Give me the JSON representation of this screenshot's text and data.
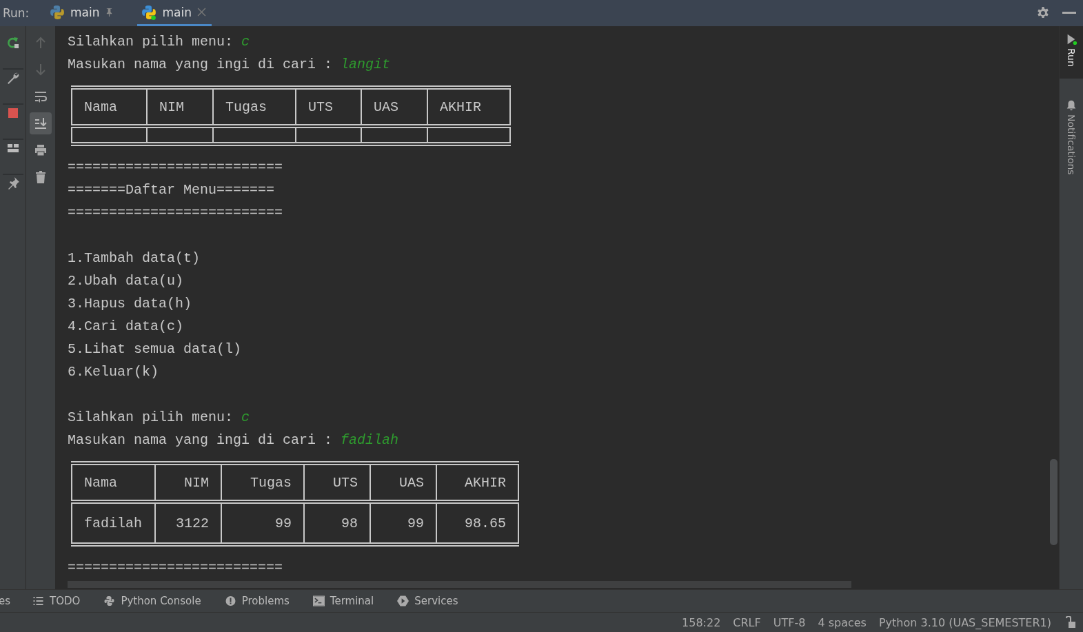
{
  "run_bar": {
    "label": "Run:",
    "tabs": [
      {
        "label": "main",
        "selected": false,
        "pinned": true,
        "running": false
      },
      {
        "label": "main",
        "selected": true,
        "pinned": false,
        "running": true
      }
    ]
  },
  "side_tools": [
    {
      "kind": "rerun"
    },
    {
      "kind": "wrench"
    },
    {
      "kind": "stop"
    },
    {
      "kind": "layout"
    },
    {
      "kind": "pin"
    }
  ],
  "console_tools": [
    {
      "kind": "up",
      "selected": false
    },
    {
      "kind": "down",
      "selected": false
    },
    {
      "kind": "wrap",
      "selected": false
    },
    {
      "kind": "scroll_end",
      "selected": true
    },
    {
      "kind": "print",
      "selected": false
    },
    {
      "kind": "trash",
      "selected": false
    }
  ],
  "console": [
    {
      "kind": "prompt",
      "text": "Silahkan pilih menu:",
      "input": "c"
    },
    {
      "kind": "prompt",
      "text": "Masukan nama yang ingi di cari :",
      "input": "langit"
    },
    {
      "kind": "table",
      "right_aligned": false,
      "columns": [
        "Nama",
        "NIM",
        "Tugas",
        "UTS",
        "UAS",
        "AKHIR"
      ]
    },
    {
      "kind": "text",
      "text": "=========================="
    },
    {
      "kind": "text",
      "text": "=======Daftar Menu======="
    },
    {
      "kind": "text",
      "text": "=========================="
    },
    {
      "kind": "blank"
    },
    {
      "kind": "text",
      "text": "1.Tambah data(t)"
    },
    {
      "kind": "text",
      "text": "2.Ubah data(u)"
    },
    {
      "kind": "text",
      "text": "3.Hapus data(h)"
    },
    {
      "kind": "text",
      "text": "4.Cari data(c)"
    },
    {
      "kind": "text",
      "text": "5.Lihat semua data(l)"
    },
    {
      "kind": "text",
      "text": "6.Keluar(k)"
    },
    {
      "kind": "blank"
    },
    {
      "kind": "prompt",
      "text": "Silahkan pilih menu:",
      "input": "c"
    },
    {
      "kind": "prompt",
      "text": "Masukan nama yang ingi di cari :",
      "input": "fadilah"
    },
    {
      "kind": "table",
      "right_aligned": true,
      "columns": [
        "Nama",
        "NIM",
        "Tugas",
        "UTS",
        "UAS",
        "AKHIR"
      ],
      "rows": [
        [
          "fadilah",
          "3122",
          "99",
          "98",
          "99",
          "98.65"
        ]
      ]
    },
    {
      "kind": "text",
      "text": "=========================="
    }
  ],
  "right_strip": [
    {
      "label": "Run",
      "kind": "run",
      "selected": true
    },
    {
      "label": "Notifications",
      "kind": "bell",
      "selected": false
    }
  ],
  "tool_windows": [
    {
      "label": "es",
      "kind": "none"
    },
    {
      "label": "TODO",
      "kind": "list"
    },
    {
      "label": "Python Console",
      "kind": "python"
    },
    {
      "label": "Problems",
      "kind": "alert"
    },
    {
      "label": "Terminal",
      "kind": "terminal"
    },
    {
      "label": "Services",
      "kind": "services"
    }
  ],
  "status_bar": [
    "158:22",
    "CRLF",
    "UTF-8",
    "4 spaces",
    "Python 3.10 (UAS_SEMESTER1)"
  ]
}
